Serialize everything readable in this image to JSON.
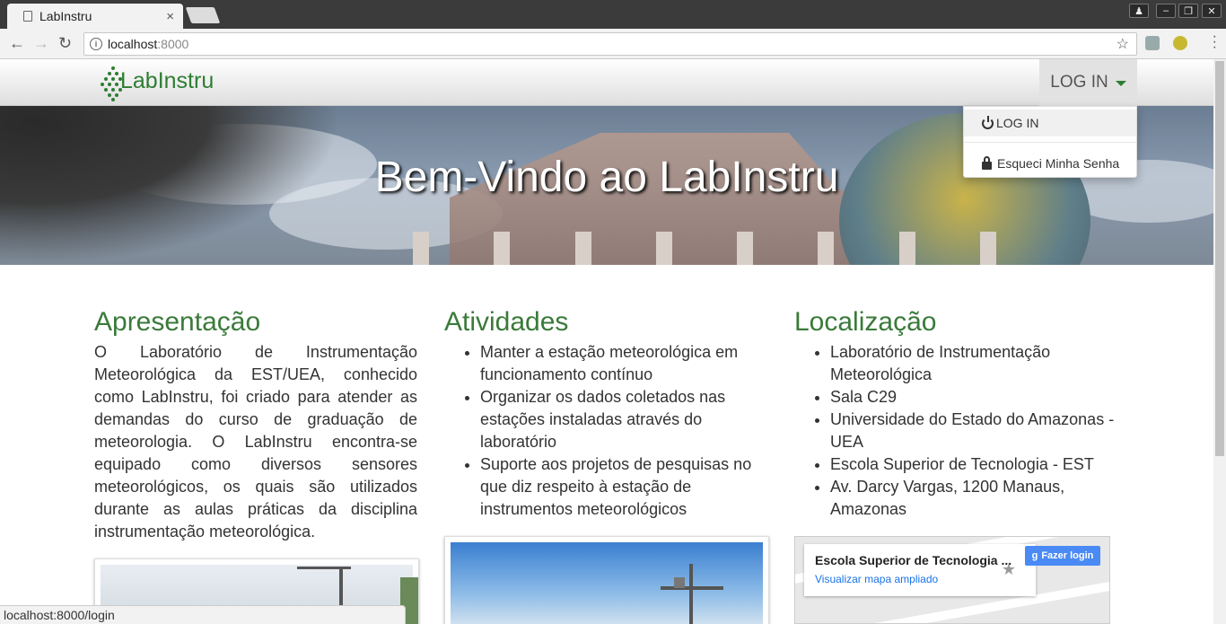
{
  "browser": {
    "tab_title": "LabInstru",
    "tab_close": "×",
    "url_host": "localhost",
    "url_port": ":8000",
    "status_url": "localhost:8000/login"
  },
  "navbar": {
    "logo_text": "LabInstru",
    "login_toggle": "LOG IN",
    "dropdown": {
      "login": "LOG IN",
      "forgot_password": "Esqueci Minha Senha"
    }
  },
  "hero": {
    "title": "Bem-Vindo ao LabInstru"
  },
  "sections": {
    "apresentacao": {
      "title": "Apresentação",
      "text": "O Laboratório de Instrumentação Meteorológica da EST/UEA, conhecido como LabInstru, foi criado para atender as demandas do curso de graduação de meteorologia. O LabInstru encontra-se equipado como diversos sensores meteorológicos, os quais são utilizados durante as aulas práticas da disciplina instrumentação meteorológica."
    },
    "atividades": {
      "title": "Atividades",
      "items": [
        "Manter a estação meteorológica em funcionamento contínuo",
        "Organizar os dados coletados nas estações instaladas através do laboratório",
        "Suporte aos projetos de pesquisas no que diz respeito à estação de instrumentos meteorológicos"
      ]
    },
    "localizacao": {
      "title": "Localização",
      "items": [
        "Laboratório de Instrumentação Meteorológica",
        "Sala C29",
        "Universidade do Estado do Amazonas - UEA",
        "Escola Superior de Tecnologia - EST",
        "Av. Darcy Vargas, 1200 Manaus, Amazonas"
      ]
    }
  },
  "map": {
    "place_title": "Escola Superior de Tecnologia ...",
    "view_larger": "Visualizar mapa ampliado",
    "login_button": "Fazer login"
  },
  "colors": {
    "brand_green": "#3a7a3a",
    "link_blue": "#1a73e8"
  }
}
